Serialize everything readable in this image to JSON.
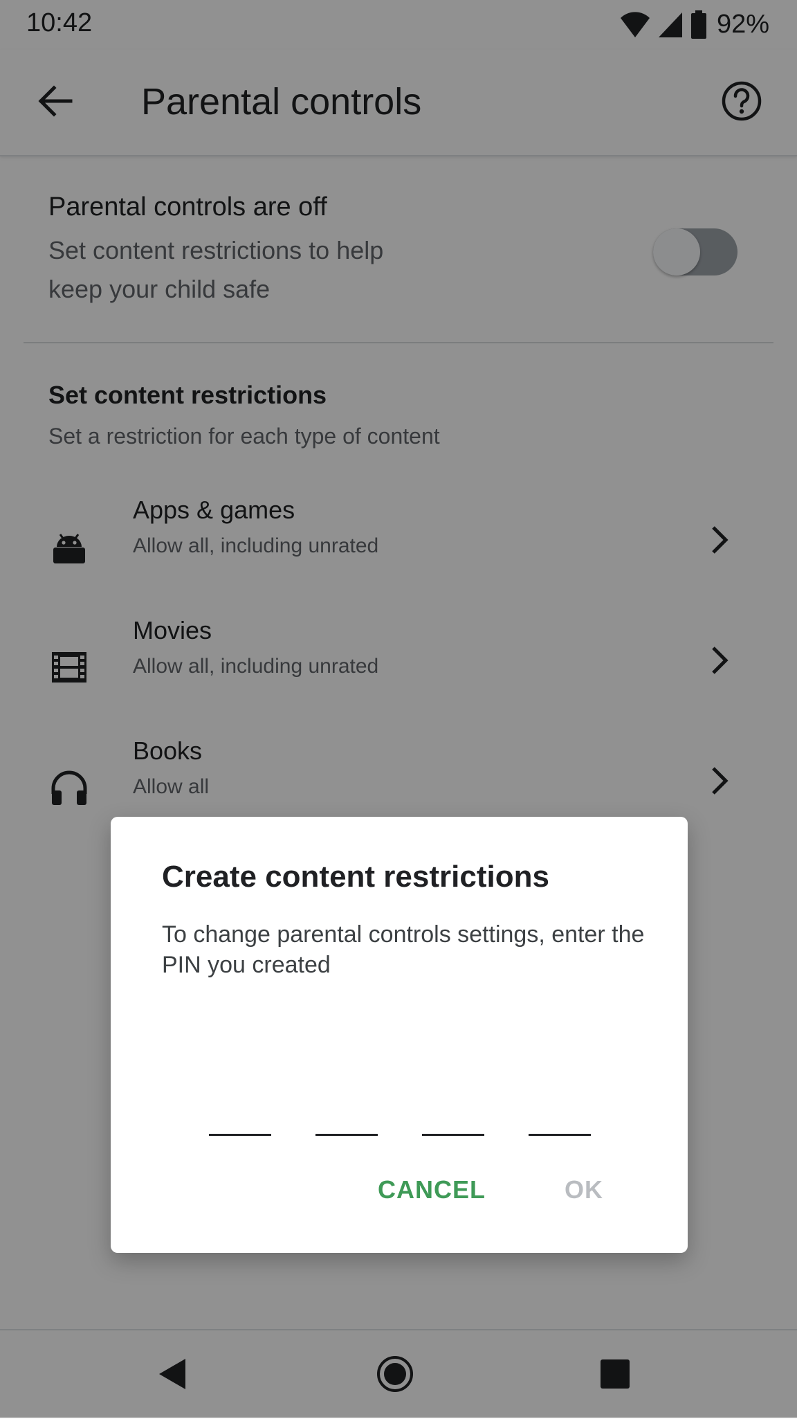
{
  "status_bar": {
    "time": "10:42",
    "battery": "92%",
    "icons": [
      "wifi-icon",
      "signal-icon",
      "battery-icon"
    ]
  },
  "app_bar": {
    "title": "Parental controls",
    "back_icon": "arrow-back-icon",
    "help_icon": "help-circle-icon"
  },
  "master_toggle": {
    "title": "Parental controls are off",
    "description": "Set content restrictions to help keep your child safe",
    "on": false
  },
  "restrictions": {
    "title": "Set content restrictions",
    "subtitle": "Set a restriction for each type of content",
    "items": [
      {
        "title": "Apps & games",
        "subtitle": "Allow all, including unrated",
        "icon": "android-icon"
      },
      {
        "title": "Movies",
        "subtitle": "Allow all, including unrated",
        "icon": "film-icon"
      },
      {
        "title": "Books",
        "subtitle": "Allow all",
        "icon": "headphones-icon"
      }
    ]
  },
  "dialog": {
    "title": "Create content restrictions",
    "body": "To change parental controls settings, enter the PIN you created",
    "pin_length": 4,
    "cancel_label": "CANCEL",
    "ok_label": "OK",
    "accent_color": "#3f9a57",
    "disabled_color": "#b9bcc0"
  },
  "nav_bar": {
    "buttons": [
      "back-triangle-icon",
      "home-circle-icon",
      "recents-square-icon"
    ]
  }
}
